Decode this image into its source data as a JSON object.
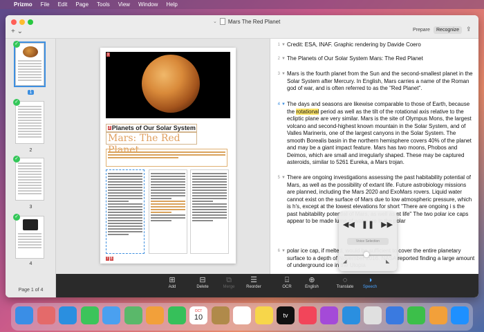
{
  "menubar": {
    "apple": "",
    "app_name": "Prizmo",
    "items": [
      "File",
      "Edit",
      "Page",
      "Tools",
      "View",
      "Window",
      "Help"
    ]
  },
  "window": {
    "doc_title": "Mars The Red Planet",
    "prepare_label": "Prepare",
    "recognize_label": "Recognize"
  },
  "sidebar": {
    "pages": [
      {
        "num": "1",
        "checked": true,
        "selected": true
      },
      {
        "num": "2",
        "checked": true,
        "selected": false
      },
      {
        "num": "3",
        "checked": true,
        "selected": false
      },
      {
        "num": "4",
        "checked": true,
        "selected": false
      }
    ],
    "page_of": "Page 1 of 4"
  },
  "page": {
    "heading1": "Planets of Our Solar System",
    "heading2": "Mars: The Red Planet",
    "tag1": "1",
    "tag2": "2",
    "tag3": "3",
    "tag4": "4",
    "tag5": "5",
    "tag6": "6",
    "tag7": "7",
    "tag8": "8"
  },
  "text_blocks": [
    {
      "num": "1",
      "text": "Credit: ESA, INAF. Graphic rendering by Davide Coero"
    },
    {
      "num": "2",
      "text": "The Planets of Our Solar System Mars: The Red Planet"
    },
    {
      "num": "3",
      "text": "Mars is the fourth planet from the Sun and the second-smallest planet in the Solar System after Mercury. In English, Mars carries a name of the Roman god of war, and is often referred to as the \"Red Planet\"."
    },
    {
      "num": "4",
      "text_before": "The days and seasons are likewise comparable to those of Earth, because the ",
      "highlight": "rotational",
      "text_after": " period as well as the tilt of the rotational axis relative to the ecliptic plane are very similar. Mars is the site of Olympus Mons, the largest volcano and second-highest known mountain in the Solar System, and of Valles Marineris, one of the largest canyons in the Solar System. The smooth Borealis basin in the northern hemisphere covers 40% of the planet and may be a giant impact feature. Mars has two moons, Phobos and Deimos, which are small and irregularly shaped. These may be captured asteroids, similar to 5261 Eureka, a Mars trojan."
    },
    {
      "num": "5",
      "text": "There are ongoing investigations assessing the past habitability potential of Mars, as well as the possibility of extant life. Future astrobiology missions are planned, including the Mars 2020 and ExoMars rovers. Liquid water cannot exist on the surface of Mars due to low atmospheric pressure, which is                            h's, except at the lowest elevations for short                            \"There are ongoing i                    s the past habitability potential of Mars, as well as                    nt life\" The two polar ice caps appear to be made                    lume of water ice in the polar"
    },
    {
      "num": "6",
      "text": "polar ice cap, if melted, would be sufficient to cover the entire planetary surface to a depth of                    November 2016. NASA reported finding a large amount of underground ice in the Utopia"
    }
  ],
  "toolbar": {
    "items": [
      {
        "label": "Add",
        "icon": "add-page-icon",
        "glyph": "⊞",
        "state": "normal"
      },
      {
        "label": "Delete",
        "icon": "delete-icon",
        "glyph": "⊟",
        "state": "normal"
      },
      {
        "label": "Merge",
        "icon": "merge-icon",
        "glyph": "⧉",
        "state": "disabled"
      },
      {
        "label": "Reorder",
        "icon": "reorder-icon",
        "glyph": "☰",
        "state": "normal"
      },
      {
        "label": "OCR",
        "icon": "ocr-icon",
        "glyph": "⌸",
        "state": "normal"
      },
      {
        "label": "English",
        "icon": "globe-icon",
        "glyph": "⊕",
        "state": "normal"
      },
      {
        "label": "Translate",
        "icon": "translate-icon",
        "glyph": "◌",
        "state": "normal"
      },
      {
        "label": "Speech",
        "icon": "speech-icon",
        "glyph": "◑",
        "state": "active"
      }
    ]
  },
  "speech_popup": {
    "rewind": "◀◀",
    "pause": "❚❚",
    "forward": "▶▶",
    "voice_label": "Voice Selection",
    "speed_level": 0.5
  },
  "dock": {
    "calendar_month": "OCT",
    "calendar_day": "10",
    "tv_label": "tv",
    "icons": [
      {
        "name": "finder-icon",
        "color": "#3a8ee6"
      },
      {
        "name": "launchpad-icon",
        "color": "#e46a6a"
      },
      {
        "name": "safari-icon",
        "color": "#2a8fe0"
      },
      {
        "name": "messages-icon",
        "color": "#3cc45a"
      },
      {
        "name": "mail-icon",
        "color": "#4aa0f0"
      },
      {
        "name": "maps-icon",
        "color": "#5ab86a"
      },
      {
        "name": "photos-icon",
        "color": "#f2a03a"
      },
      {
        "name": "facetime-icon",
        "color": "#36c05a"
      },
      {
        "name": "calendar-icon",
        "color": "#ffffff"
      },
      {
        "name": "prizmo-icon",
        "color": "#b08a4a"
      },
      {
        "name": "reminders-icon",
        "color": "#ffffff"
      },
      {
        "name": "notes-icon",
        "color": "#f7d64a"
      },
      {
        "name": "apple-tv-icon",
        "color": "#111111"
      },
      {
        "name": "music-icon",
        "color": "#f2455a"
      },
      {
        "name": "podcasts-icon",
        "color": "#a44ad8"
      },
      {
        "name": "app-store-icon",
        "color": "#2a8fe0"
      },
      {
        "name": "dictionary-icon",
        "color": "#e0e0e0"
      },
      {
        "name": "keynote-icon",
        "color": "#3a7ae0"
      },
      {
        "name": "numbers-icon",
        "color": "#3cbf4a"
      },
      {
        "name": "pages-icon",
        "color": "#f2a03a"
      },
      {
        "name": "appstore2-icon",
        "color": "#1e90ff"
      }
    ]
  }
}
